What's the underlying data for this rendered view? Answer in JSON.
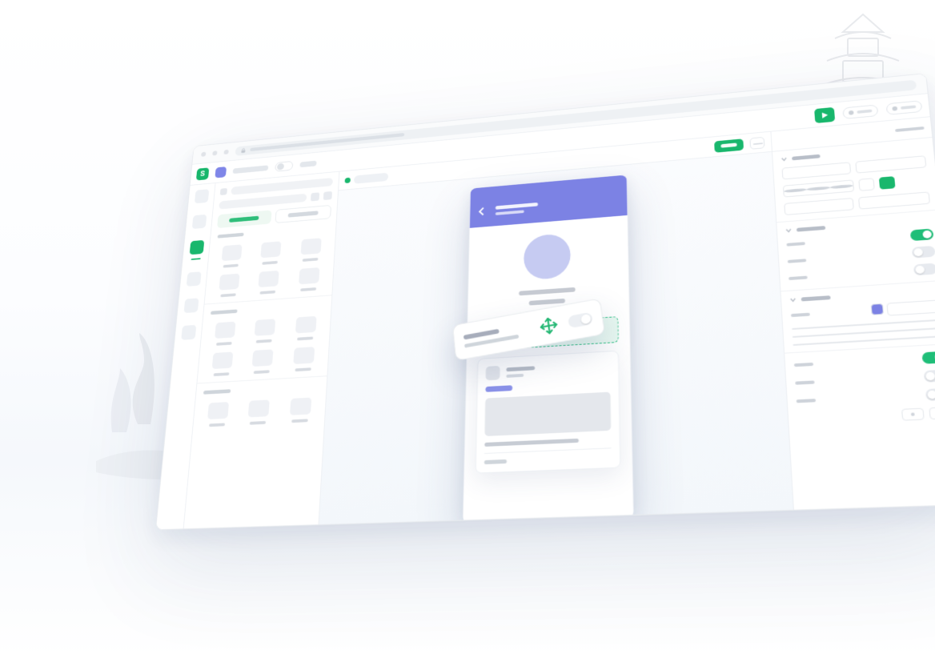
{
  "colors": {
    "accent_green": "#19b76d",
    "accent_purple": "#7c82e4"
  },
  "browser": {
    "url_placeholder": ""
  },
  "toolbar": {
    "logo_letter": "S",
    "project_name": "",
    "device_toggle_label": "",
    "preview_label": ""
  },
  "rail": {
    "items": [
      {
        "id": "pages",
        "active": false
      },
      {
        "id": "components",
        "active": false
      },
      {
        "id": "layers",
        "active": true
      },
      {
        "id": "database",
        "active": false
      },
      {
        "id": "assets",
        "active": false
      },
      {
        "id": "settings",
        "active": false
      }
    ]
  },
  "components_panel": {
    "search_placeholder": "",
    "tabs": [
      {
        "id": "components",
        "label": "",
        "active": true
      },
      {
        "id": "blocks",
        "label": "",
        "active": false
      }
    ],
    "groups": [
      {
        "title": "",
        "items": [
          "",
          "",
          "",
          "",
          "",
          ""
        ]
      },
      {
        "title": "",
        "items": [
          "",
          "",
          "",
          "",
          "",
          ""
        ]
      },
      {
        "title": "",
        "items": [
          "",
          "",
          ""
        ]
      }
    ]
  },
  "canvas": {
    "page_chip": {
      "status": "active",
      "label": ""
    },
    "primary_action_label": "",
    "dragging_block": {
      "title": "",
      "subtitle": ""
    },
    "phone": {
      "appbar_title": "",
      "appbar_subtitle": "",
      "card": {
        "title": "",
        "subtitle": "",
        "badge": "",
        "footer": ""
      }
    }
  },
  "inspector": {
    "sections": [
      {
        "id": "layout",
        "label": "",
        "collapsed": false
      },
      {
        "id": "visibility",
        "label": "",
        "collapsed": false
      },
      {
        "id": "style",
        "label": "",
        "collapsed": false
      },
      {
        "id": "state",
        "label": "",
        "collapsed": false
      }
    ],
    "toggles": {
      "visible": true,
      "flag_a": false,
      "flag_b": false,
      "state_enabled": true,
      "state_b": false,
      "state_c": false
    },
    "color_value": "#7c82e4"
  }
}
